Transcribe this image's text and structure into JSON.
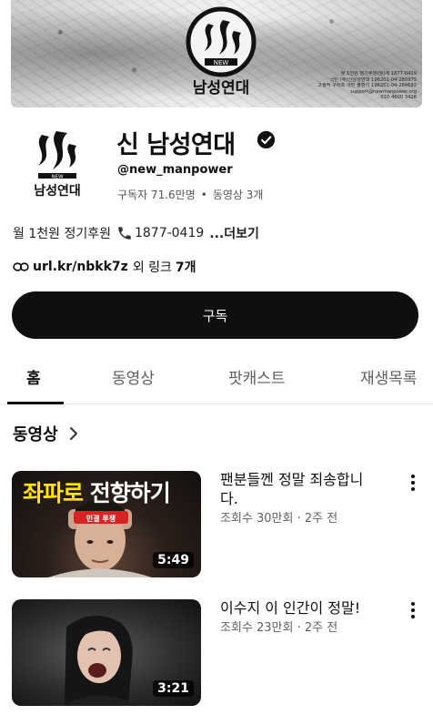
{
  "banner": {
    "logo_word": "NEW",
    "logo_text": "남성연대",
    "info_lines": [
      "월 1천원 정기후원(월)계 1877-0419",
      "국민 (주)신남성연대 196201-04-280975",
      "고생적 구하조 국민 출판기 196201-04-284692",
      "support@newmanpower.org",
      "010 4600 3426"
    ]
  },
  "channel": {
    "avatar_word": "NEW",
    "avatar_text": "남성연대",
    "name": "신 남성연대",
    "handle": "@new_manpower",
    "subscribers": "구독자 71.6만명",
    "separator": "•",
    "video_count": "동영상 3개",
    "description": "월 1천원 정기후원",
    "phone": "1877-0419",
    "more": "...더보기",
    "link_url": "url.kr/nbkk7z",
    "link_suffix": "외 링크",
    "link_count": "7개",
    "subscribe_label": "구독"
  },
  "tabs": [
    {
      "label": "홈",
      "active": true
    },
    {
      "label": "동영상",
      "active": false
    },
    {
      "label": "팟캐스트",
      "active": false
    },
    {
      "label": "재생목록",
      "active": false
    }
  ],
  "section": {
    "title": "동영상"
  },
  "videos": [
    {
      "thumb_highlight": "좌파로",
      "thumb_rest": " 전향하기",
      "headband": "민결 투쟁",
      "duration": "5:49",
      "title": "팬분들껜 정말 죄송합니다.",
      "meta": "조회수 30만회 · 2주 전"
    },
    {
      "duration": "3:21",
      "title": "이수지 이 인간이 정말!",
      "meta": "조회수 23만회 · 2주 전"
    }
  ],
  "colors": {
    "text": "#0f0f0f",
    "secondary": "#606060",
    "subscribe_bg": "#0f0f0f",
    "thumb_highlight": "#ffe600",
    "headband": "#d62323"
  }
}
